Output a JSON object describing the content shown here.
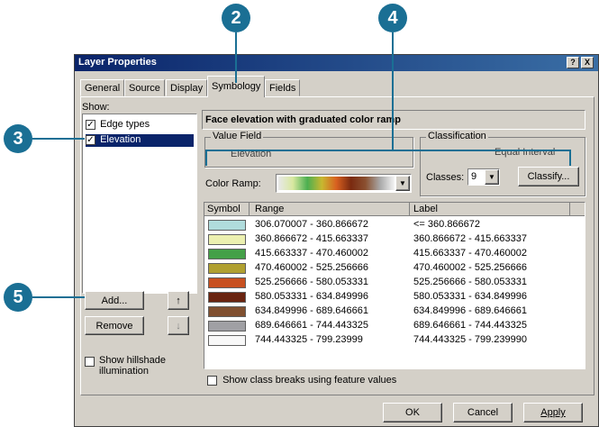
{
  "callouts": {
    "c2": "2",
    "c4": "4",
    "c3": "3",
    "c5": "5"
  },
  "window": {
    "title": "Layer Properties",
    "help_button": "?",
    "close_button": "X"
  },
  "tabs": [
    "General",
    "Source",
    "Display",
    "Symbology",
    "Fields"
  ],
  "show_panel": {
    "label": "Show:",
    "items": [
      {
        "label": "Edge types",
        "checked": true,
        "selected": false
      },
      {
        "label": "Elevation",
        "checked": true,
        "selected": true
      }
    ],
    "add_button": "Add...",
    "remove_button": "Remove",
    "up_icon": "up-arrow-icon",
    "down_icon": "down-arrow-icon",
    "hillshade_label_1": "Show hillshade",
    "hillshade_label_2": "illumination"
  },
  "symbology": {
    "heading": "Face elevation with graduated color ramp",
    "value_field_legend": "Value Field",
    "value_field_value": "Elevation",
    "classification_legend": "Classification",
    "classification_method": "Equal Interval",
    "classes_label": "Classes:",
    "classes_value": "9",
    "classify_button": "Classify...",
    "color_ramp_label": "Color Ramp:",
    "ramp_colors": [
      "#e8e8e8",
      "#d8e8a0",
      "#4caf50",
      "#c8b830",
      "#d86020",
      "#7a2a10",
      "#8a5030",
      "#a8a8a8",
      "#f4f4f4"
    ],
    "columns": {
      "symbol": "Symbol",
      "range": "Range",
      "label": "Label"
    },
    "rows": [
      {
        "color": "#b0dcdc",
        "range": "306.070007 - 360.866672",
        "label": "<= 360.866672"
      },
      {
        "color": "#ecf0b0",
        "range": "360.866672 - 415.663337",
        "label": "360.866672 - 415.663337"
      },
      {
        "color": "#44a048",
        "range": "415.663337 - 470.460002",
        "label": "415.663337 - 470.460002"
      },
      {
        "color": "#b0a030",
        "range": "470.460002 - 525.256666",
        "label": "470.460002 - 525.256666"
      },
      {
        "color": "#c85020",
        "range": "525.256666 - 580.053331",
        "label": "525.256666 - 580.053331"
      },
      {
        "color": "#6a2410",
        "range": "580.053331 - 634.849996",
        "label": "580.053331 - 634.849996"
      },
      {
        "color": "#805030",
        "range": "634.849996 - 689.646661",
        "label": "634.849996 - 689.646661"
      },
      {
        "color": "#a0a0a4",
        "range": "689.646661 - 744.443325",
        "label": "689.646661 - 744.443325"
      },
      {
        "color": "#f8f8f8",
        "range": "744.443325 - 799.23999",
        "label": "744.443325 - 799.239990"
      }
    ],
    "show_breaks_label": "Show class breaks using feature values"
  },
  "footer": {
    "ok": "OK",
    "cancel": "Cancel",
    "apply": "Apply"
  }
}
